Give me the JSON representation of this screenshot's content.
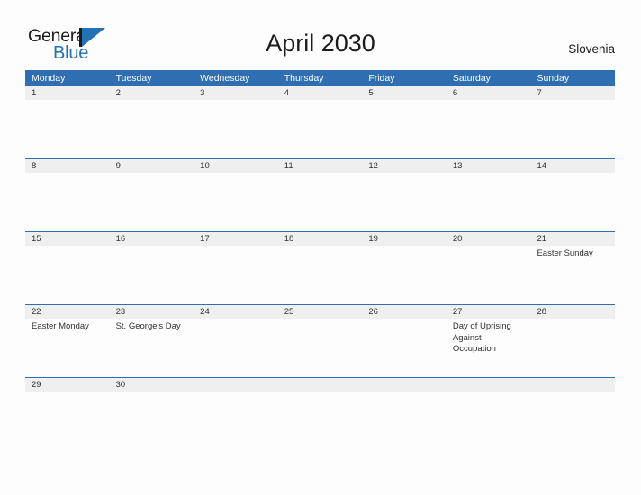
{
  "brand": {
    "name_top": "General",
    "name_bottom": "Blue",
    "accent_color": "#2370b5"
  },
  "header": {
    "title": "April 2030",
    "region": "Slovenia",
    "header_color": "#2f6eb0",
    "band_color": "#efefef"
  },
  "calendar": {
    "weekdays": [
      "Monday",
      "Tuesday",
      "Wednesday",
      "Thursday",
      "Friday",
      "Saturday",
      "Sunday"
    ],
    "weeks": [
      [
        {
          "day": "1",
          "event": ""
        },
        {
          "day": "2",
          "event": ""
        },
        {
          "day": "3",
          "event": ""
        },
        {
          "day": "4",
          "event": ""
        },
        {
          "day": "5",
          "event": ""
        },
        {
          "day": "6",
          "event": ""
        },
        {
          "day": "7",
          "event": ""
        }
      ],
      [
        {
          "day": "8",
          "event": ""
        },
        {
          "day": "9",
          "event": ""
        },
        {
          "day": "10",
          "event": ""
        },
        {
          "day": "11",
          "event": ""
        },
        {
          "day": "12",
          "event": ""
        },
        {
          "day": "13",
          "event": ""
        },
        {
          "day": "14",
          "event": ""
        }
      ],
      [
        {
          "day": "15",
          "event": ""
        },
        {
          "day": "16",
          "event": ""
        },
        {
          "day": "17",
          "event": ""
        },
        {
          "day": "18",
          "event": ""
        },
        {
          "day": "19",
          "event": ""
        },
        {
          "day": "20",
          "event": ""
        },
        {
          "day": "21",
          "event": "Easter Sunday"
        }
      ],
      [
        {
          "day": "22",
          "event": "Easter Monday"
        },
        {
          "day": "23",
          "event": "St. George's Day"
        },
        {
          "day": "24",
          "event": ""
        },
        {
          "day": "25",
          "event": ""
        },
        {
          "day": "26",
          "event": ""
        },
        {
          "day": "27",
          "event": "Day of Uprising\nAgainst Occupation"
        },
        {
          "day": "28",
          "event": ""
        }
      ],
      [
        {
          "day": "29",
          "event": ""
        },
        {
          "day": "30",
          "event": ""
        },
        {
          "day": "",
          "event": ""
        },
        {
          "day": "",
          "event": ""
        },
        {
          "day": "",
          "event": ""
        },
        {
          "day": "",
          "event": ""
        },
        {
          "day": "",
          "event": ""
        }
      ]
    ]
  }
}
